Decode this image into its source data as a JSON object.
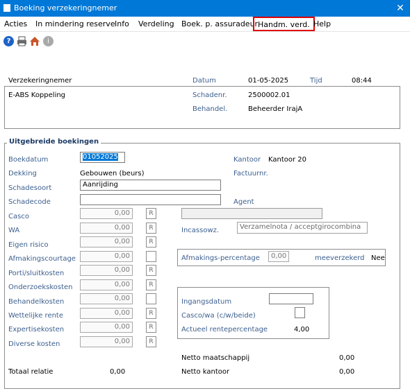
{
  "window": {
    "title": "Boeking verzekeringnemer",
    "close_glyph": "✕"
  },
  "menu": {
    "items": [
      "Acties",
      "In mindering reserve",
      "Info",
      "Verdeling",
      "Boek. p. assuradeur",
      "Handm. verd.",
      "Help"
    ]
  },
  "toolbar": {
    "help_glyph": "?",
    "info_glyph": "i"
  },
  "header": {
    "verzekeringnemer_label": "Verzekeringnemer",
    "datum_label": "Datum",
    "datum_value": "01-05-2025",
    "tijd_label": "Tijd",
    "tijd_value": "08:44",
    "relation_name": "E-ABS Koppeling",
    "schadenr_label": "Schadenr.",
    "schadenr_value": "2500002.01",
    "behandel_label": "Behandel.",
    "behandel_value": "Beheerder IrajA"
  },
  "section": {
    "title": "Uitgebreide boekingen",
    "boekdatum_label": "Boekdatum",
    "boekdatum_value": "01052025",
    "kantoor_label": "Kantoor",
    "kantoor_value": "Kantoor 20",
    "dekking_label": "Dekking",
    "dekking_value": "Gebouwen (beurs)",
    "factuurnr_label": "Factuurnr.",
    "schadesoort_label": "Schadesoort",
    "schadesoort_value": "Aanrijding",
    "schadecode_label": "Schadecode",
    "schadecode_value": "",
    "agent_label": "Agent",
    "incassowz_label": "Incassowz.",
    "incassowz_value": "Verzamelnota / acceptgirocombina",
    "afmakings_label": "Afmakings-percentage",
    "afmakings_value": "0,00",
    "meeverzekerd_label": "meeverzekerd",
    "meeverzekerd_value": "Nee",
    "ingangsdatum_label": "Ingangsdatum",
    "cascowa_label": "Casco/wa (c/w/beide)",
    "rente_label": "Actueel rentepercentage",
    "rente_value": "4,00"
  },
  "amounts": [
    {
      "label": "Casco",
      "value": "0,00",
      "flag": "R"
    },
    {
      "label": "WA",
      "value": "0,00",
      "flag": "R"
    },
    {
      "label": "Eigen risico",
      "value": "0,00",
      "flag": "R"
    },
    {
      "label": "Afmakingscourtage",
      "value": "0,00",
      "flag": ""
    },
    {
      "label": "Porti/sluitkosten",
      "value": "0,00",
      "flag": "R"
    },
    {
      "label": "Onderzoekskosten",
      "value": "0,00",
      "flag": "R"
    },
    {
      "label": "Behandelkosten",
      "value": "0,00",
      "flag": ""
    },
    {
      "label": "Wettelijke rente",
      "value": "0,00",
      "flag": "R"
    },
    {
      "label": "Expertisekosten",
      "value": "0,00",
      "flag": "R"
    },
    {
      "label": "Diverse kosten",
      "value": "0,00",
      "flag": "R"
    }
  ],
  "totals": {
    "netto_maatschappij_label": "Netto maatschappij",
    "netto_maatschappij_value": "0,00",
    "totaal_relatie_label": "Totaal relatie",
    "totaal_relatie_value": "0,00",
    "netto_kantoor_label": "Netto kantoor",
    "netto_kantoor_value": "0,00"
  }
}
